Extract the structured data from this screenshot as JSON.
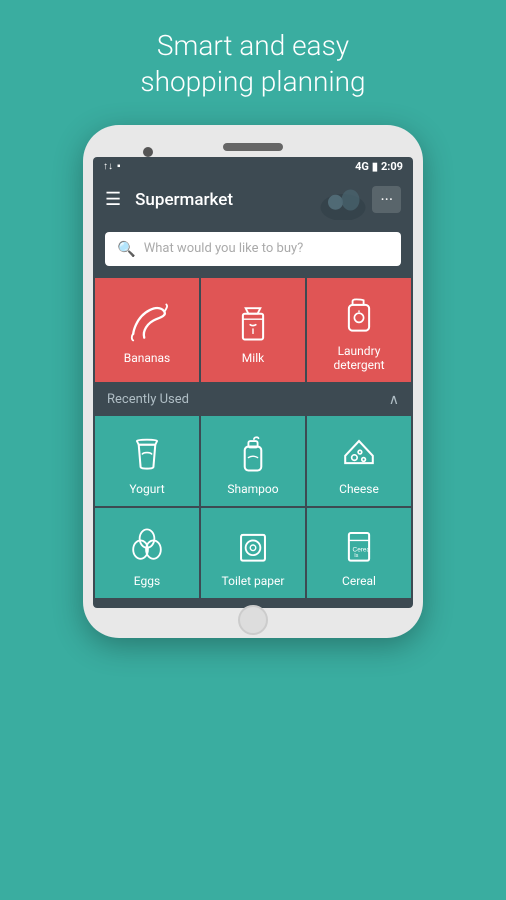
{
  "headline": {
    "line1": "Smart and easy",
    "line2": "shopping planning"
  },
  "status_bar": {
    "left": "↑↓",
    "network": "4G",
    "time": "2:09"
  },
  "app_bar": {
    "title": "Supermarket",
    "chat_icon": "💬"
  },
  "search": {
    "placeholder": "What would you like to buy?"
  },
  "cart_items": [
    {
      "label": "Bananas",
      "icon_type": "banana"
    },
    {
      "label": "Milk",
      "icon_type": "milk"
    },
    {
      "label": "Laundry detergent",
      "icon_type": "detergent"
    }
  ],
  "recently_used": {
    "section_title": "Recently Used",
    "items": [
      {
        "label": "Yogurt",
        "icon_type": "yogurt"
      },
      {
        "label": "Shampoo",
        "icon_type": "shampoo"
      },
      {
        "label": "Cheese",
        "icon_type": "cheese"
      },
      {
        "label": "Eggs",
        "icon_type": "eggs"
      },
      {
        "label": "Toilet paper",
        "icon_type": "toilet_paper"
      },
      {
        "label": "Cereal",
        "icon_type": "cereal"
      }
    ]
  }
}
